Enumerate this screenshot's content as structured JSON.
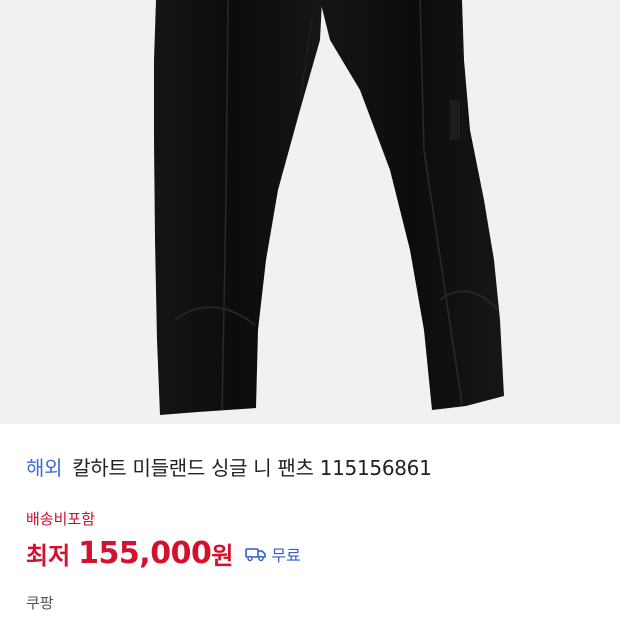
{
  "product": {
    "origin_badge": "해외",
    "title": "칼하트 미들랜드 싱글 니 팬츠 115156861",
    "shipping_note": "배송비포함",
    "price_prefix": "최저",
    "price_value": "155,000",
    "price_unit": "원",
    "delivery_label": "무료",
    "seller": "쿠팡",
    "image_icon": "black-pants-photo"
  },
  "colors": {
    "background": "#ffffff",
    "image_bg": "#f1f1f3",
    "accent_red": "#d3112d",
    "accent_blue": "#3b6fd8"
  }
}
